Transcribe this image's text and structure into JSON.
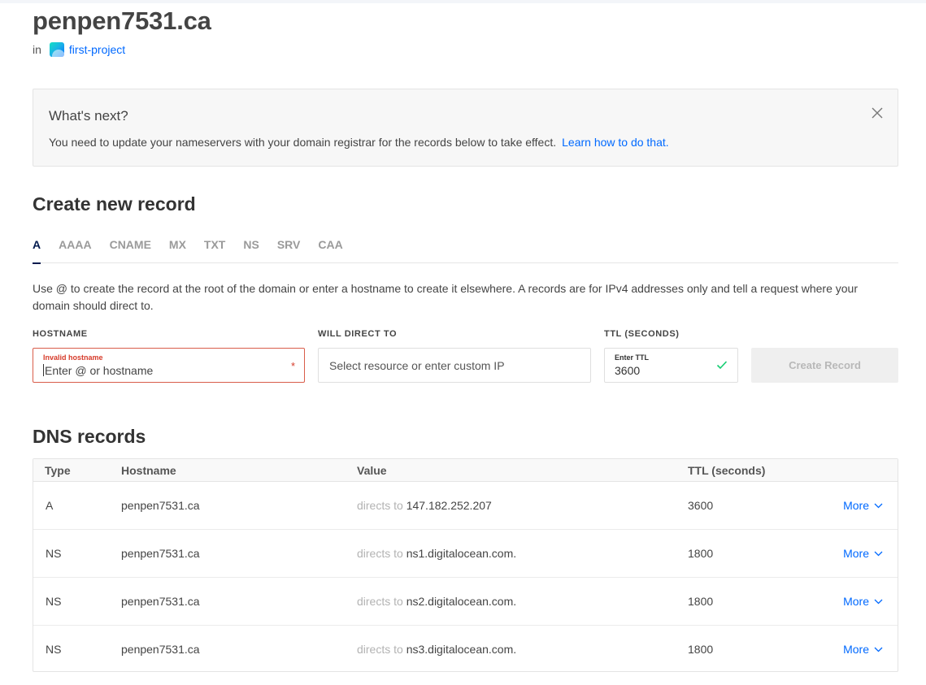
{
  "domain": {
    "name": "penpen7531.ca",
    "in_label": "in",
    "project": "first-project"
  },
  "notice": {
    "title": "What's next?",
    "body": "You need to update your nameservers with your domain registrar for the records below to take effect.",
    "link": "Learn how to do that."
  },
  "create": {
    "title": "Create new record",
    "tabs": [
      "A",
      "AAAA",
      "CNAME",
      "MX",
      "TXT",
      "NS",
      "SRV",
      "CAA"
    ],
    "active_tab": "A",
    "help": "Use @ to create the record at the root of the domain or enter a hostname to create it elsewhere. A records are for IPv4 addresses only and tell a request where your domain should direct to.",
    "hostname": {
      "label": "HOSTNAME",
      "error": "Invalid hostname",
      "placeholder": "Enter @ or hostname",
      "required_mark": "*"
    },
    "direct": {
      "label": "WILL DIRECT TO",
      "placeholder": "Select resource or enter custom IP"
    },
    "ttl": {
      "label": "TTL (SECONDS)",
      "float_label": "Enter TTL",
      "value": "3600"
    },
    "button": "Create Record"
  },
  "dns": {
    "title": "DNS records",
    "columns": [
      "Type",
      "Hostname",
      "Value",
      "TTL (seconds)"
    ],
    "directs_prefix": "directs to",
    "more_label": "More",
    "rows": [
      {
        "type": "A",
        "hostname": "penpen7531.ca",
        "value": "147.182.252.207",
        "ttl": "3600"
      },
      {
        "type": "NS",
        "hostname": "penpen7531.ca",
        "value": "ns1.digitalocean.com.",
        "ttl": "1800"
      },
      {
        "type": "NS",
        "hostname": "penpen7531.ca",
        "value": "ns2.digitalocean.com.",
        "ttl": "1800"
      },
      {
        "type": "NS",
        "hostname": "penpen7531.ca",
        "value": "ns3.digitalocean.com.",
        "ttl": "1800"
      }
    ]
  },
  "colors": {
    "link": "#0069ff",
    "error": "#d63b2a",
    "success": "#15cd72",
    "nav_active": "#031b4e"
  }
}
